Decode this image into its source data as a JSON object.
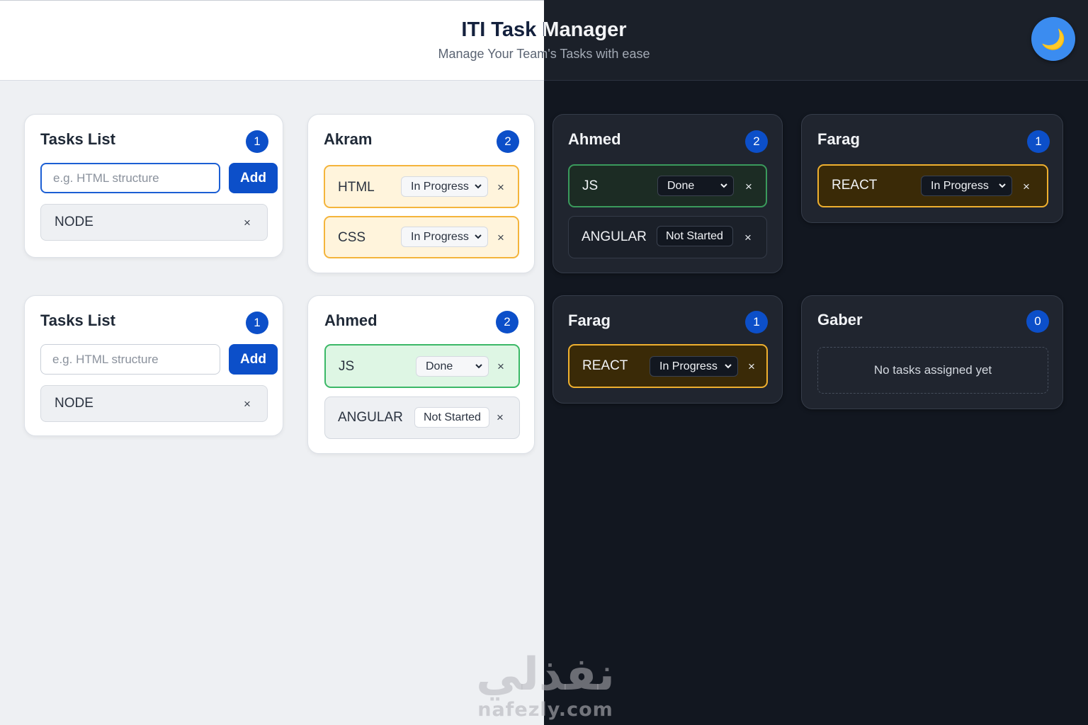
{
  "header": {
    "title": "ITI Task Manager",
    "subtitle": "Manage Your Team's Tasks with ease",
    "theme_toggle_icon": "🌙"
  },
  "colors": {
    "accent": "#0c4fc9",
    "in_progress": "#f4b43b",
    "done": "#3bb867",
    "dark_bg": "#121720",
    "light_bg": "#eef0f3"
  },
  "light_panel": {
    "pool_cards": [
      {
        "title": "Tasks List",
        "count": "1",
        "input_placeholder": "e.g. HTML structure",
        "add_label": "Add",
        "items": [
          {
            "label": "NODE",
            "remove": "×"
          }
        ]
      },
      {
        "title": "Tasks List",
        "count": "1",
        "input_placeholder": "e.g. HTML structure",
        "add_label": "Add",
        "items": [
          {
            "label": "NODE",
            "remove": "×"
          }
        ]
      }
    ],
    "member_cards": [
      {
        "name": "Akram",
        "count": "2",
        "tasks": [
          {
            "label": "HTML",
            "status": "In Progress",
            "remove": "×"
          },
          {
            "label": "CSS",
            "status": "In Progress",
            "remove": "×"
          }
        ]
      },
      {
        "name": "Ahmed",
        "count": "2",
        "tasks": [
          {
            "label": "JS",
            "status": "Done",
            "remove": "×"
          },
          {
            "label": "ANGULAR",
            "status": "Not Started",
            "remove": "×"
          }
        ]
      }
    ]
  },
  "dark_panel": {
    "member_cards": [
      {
        "name": "Ahmed",
        "count": "2",
        "tasks": [
          {
            "label": "JS",
            "status": "Done",
            "remove": "×"
          },
          {
            "label": "ANGULAR",
            "status": "Not Started",
            "remove": "×"
          }
        ]
      },
      {
        "name": "Farag",
        "count": "1",
        "tasks": [
          {
            "label": "REACT",
            "status": "In Progress",
            "remove": "×"
          }
        ]
      },
      {
        "name": "Farag",
        "count": "1",
        "tasks": [
          {
            "label": "REACT",
            "status": "In Progress",
            "remove": "×"
          }
        ]
      },
      {
        "name": "Gaber",
        "count": "0",
        "tasks": [],
        "empty_text": "No tasks assigned yet"
      }
    ]
  },
  "watermark": {
    "arabic": "نفذلي",
    "latin": "nafezly.com"
  }
}
